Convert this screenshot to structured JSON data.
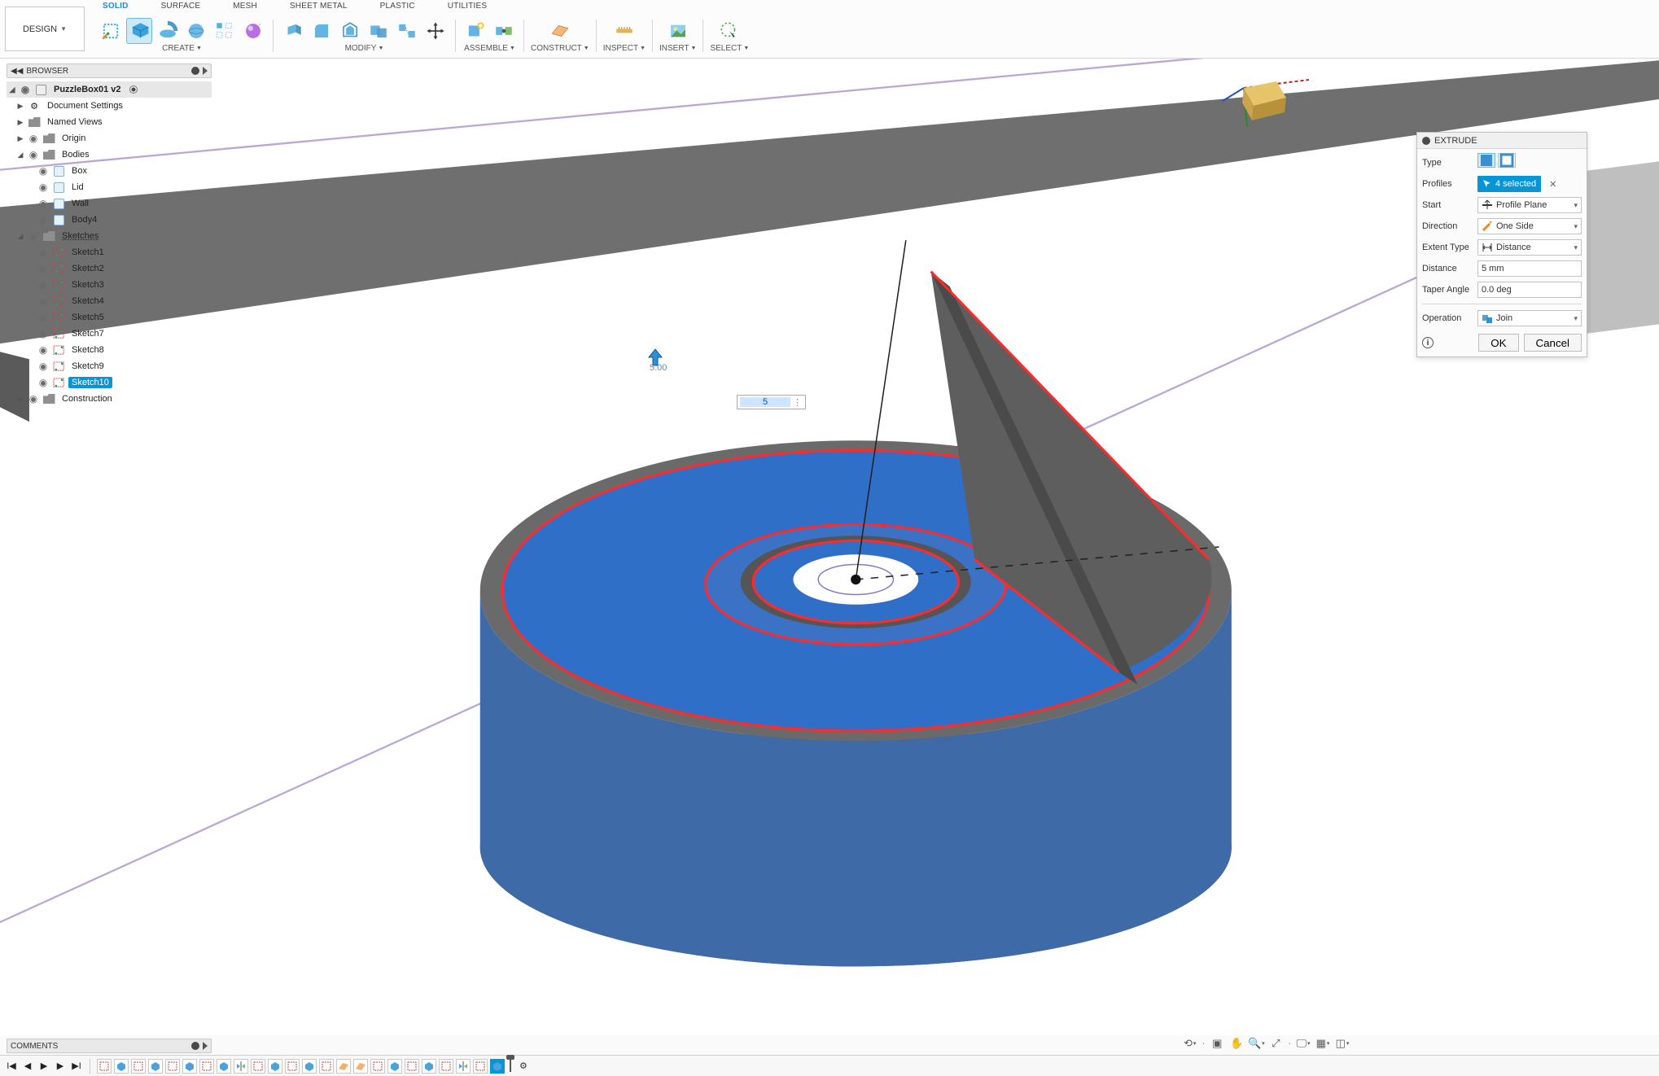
{
  "workspace_button": "DESIGN",
  "ribbon_tabs": [
    "SOLID",
    "SURFACE",
    "MESH",
    "SHEET METAL",
    "PLASTIC",
    "UTILITIES"
  ],
  "active_ribbon_tab": "SOLID",
  "ribbon_group_labels": {
    "create": "CREATE",
    "modify": "MODIFY",
    "assemble": "ASSEMBLE",
    "construct": "CONSTRUCT",
    "inspect": "INSPECT",
    "insert": "INSERT",
    "select": "SELECT"
  },
  "browser": {
    "title": "BROWSER",
    "root": "PuzzleBox01 v2",
    "document_settings": "Document Settings",
    "named_views": "Named Views",
    "origin": "Origin",
    "bodies_label": "Bodies",
    "bodies": [
      "Box",
      "Lid",
      "Wall",
      "Body4"
    ],
    "sketches_label": "Sketches",
    "sketches": [
      "Sketch1",
      "Sketch2",
      "Sketch3",
      "Sketch4",
      "Sketch5",
      "Sketch7",
      "Sketch8",
      "Sketch9",
      "Sketch10"
    ],
    "selected_sketch_index": 8,
    "construction": "Construction"
  },
  "extrude": {
    "title": "EXTRUDE",
    "labels": {
      "type": "Type",
      "profiles": "Profiles",
      "start": "Start",
      "direction": "Direction",
      "extent": "Extent Type",
      "distance": "Distance",
      "taper": "Taper Angle",
      "operation": "Operation"
    },
    "profiles_chip": "4 selected",
    "start": "Profile Plane",
    "direction": "One Side",
    "extent": "Distance",
    "distance": "5 mm",
    "taper": "0.0 deg",
    "operation": "Join",
    "ok": "OK",
    "cancel": "Cancel"
  },
  "canvas_input": {
    "value": "5"
  },
  "on_canvas_dimension": "5.00",
  "comments": {
    "title": "COMMENTS"
  },
  "timeline": {
    "count": 24,
    "current_index": 23
  }
}
